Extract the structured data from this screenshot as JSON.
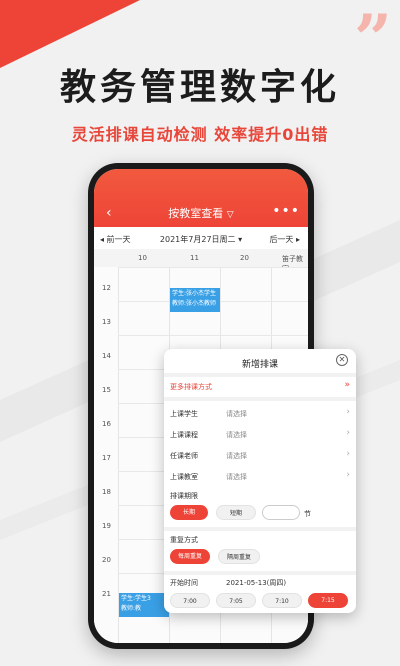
{
  "hero": {
    "headline": "教务管理数字化",
    "subline": "灵活排课自动检测 效率提升0出错",
    "quote_mark": "”"
  },
  "colors": {
    "accent": "#ee4438",
    "slot_blue": "#3aa0e6"
  },
  "app": {
    "title": "按教室查看",
    "title_chevron_icon": "chevron-down-icon",
    "back_icon": "chevron-left-icon",
    "more_icon": "more-dots-icon",
    "prev_day": "◂ 前一天",
    "date": "2021年7月27日周二 ▾",
    "next_day": "后一天 ▸",
    "columns": [
      "10",
      "11",
      "20",
      "笛子教室"
    ],
    "hours": [
      "12",
      "13",
      "14",
      "15",
      "16",
      "17",
      "18",
      "19",
      "20",
      "21"
    ],
    "slots": [
      {
        "line1": "学生:张小杰学生",
        "line2": "教师:张小杰教师"
      },
      {
        "line1": "学生:学生3",
        "line2": "教师:教"
      }
    ]
  },
  "sheet": {
    "title": "新增排课",
    "close_icon": "close-circle-icon",
    "more_way": "更多排课方式",
    "more_way_chevron": "»",
    "fields": [
      {
        "label": "上课学生",
        "value": "请选择"
      },
      {
        "label": "上课课程",
        "value": "请选择"
      },
      {
        "label": "任课老师",
        "value": "请选择"
      },
      {
        "label": "上课教室",
        "value": "请选择"
      }
    ],
    "period_label": "排课期限",
    "period_options": [
      "长期",
      "短期"
    ],
    "period_unit": "节",
    "repeat_label": "重复方式",
    "repeat_options": [
      "每周重复",
      "隔周重复"
    ],
    "start_label": "开始时间",
    "start_date": "2021-05-13(周四)",
    "time_options": [
      "7:00",
      "7:05",
      "7:10",
      "7:15"
    ]
  }
}
